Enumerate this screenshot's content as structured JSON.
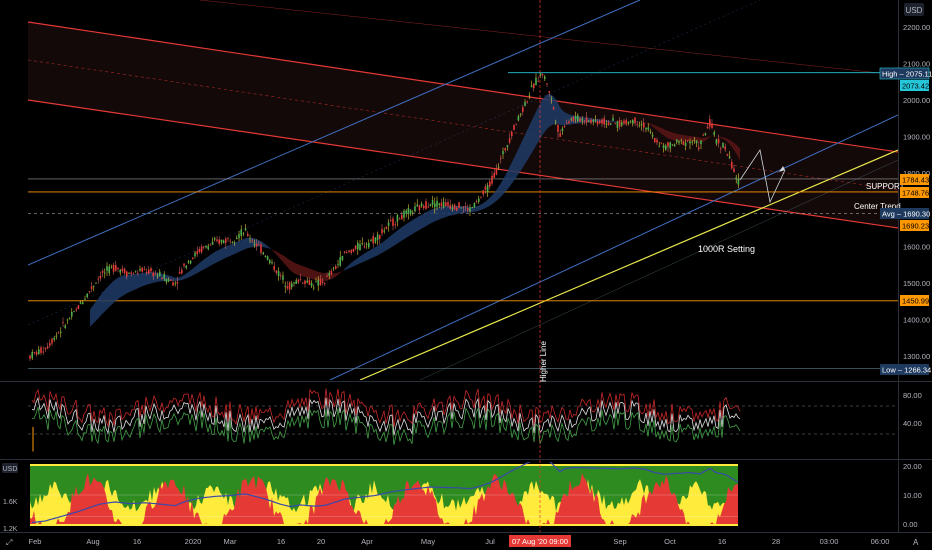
{
  "currency": "USD",
  "main_panel": {
    "price_ticks": [
      "2200.00",
      "2100.00",
      "2000.00",
      "1900.00",
      "1800.00",
      "1600.00",
      "1500.00",
      "1400.00",
      "1300.00"
    ],
    "price_tick_values": [
      2200,
      2100,
      2000,
      1900,
      1800,
      1600,
      1500,
      1400,
      1300
    ],
    "ylim": [
      1250,
      2290
    ],
    "badges": {
      "high": {
        "text": "High – 2075.11",
        "value": 2075.11
      },
      "last": {
        "text": "2073.42",
        "value": 2073.42
      },
      "r1784": {
        "text": "1784.43",
        "value": 1784.43
      },
      "r1748": {
        "text": "1748.76",
        "value": 1748.76
      },
      "avg": {
        "text": "Avg – 1690.30",
        "value": 1690.3
      },
      "r1690": {
        "text": "1690.23",
        "value": 1690.23
      },
      "r1450": {
        "text": "1450.99",
        "value": 1450.99
      },
      "low": {
        "text": "Low – 1266.34",
        "value": 1266.34
      }
    },
    "annotations": {
      "support": "SUPPORT",
      "center_trend": "Center Trend",
      "setting": "1000R Setting",
      "higher_line": "Higher Line"
    }
  },
  "rsi_panel": {
    "ticks": [
      "80.00",
      "40.00"
    ],
    "tick_values": [
      80,
      40
    ],
    "ylim": [
      0,
      100
    ]
  },
  "bottom_panel": {
    "currency": "USD",
    "left_ticks": [
      "1.6K",
      "1.2K"
    ],
    "right_ticks": [
      "20.00",
      "10.00",
      "0.00"
    ],
    "right_tick_values": [
      20,
      10,
      0
    ]
  },
  "time_axis": {
    "labels": [
      "Feb",
      "Aug",
      "16",
      "2020",
      "Mar",
      "16",
      "20",
      "Apr",
      "May",
      "Jul",
      "Sep",
      "Oct",
      "16",
      "28",
      "03:00",
      "06:00"
    ],
    "highlight": "07 Aug '20  09:00"
  },
  "chart_data": {
    "type": "line",
    "title": "",
    "series": [],
    "levels": {
      "high": 2075.11,
      "support": 1748.76,
      "avg": 1690.3,
      "lower": 1450.99,
      "low": 1266.34
    }
  },
  "colors": {
    "bg": "#000000",
    "candle_up": "#4caf50",
    "candle_down": "#e53935",
    "channel_red": "#e53935",
    "channel_blue": "#3f6fbf",
    "yellow_line": "#e8e84a",
    "orange_line": "#ff9800",
    "cyan_line": "#26c6da",
    "badge_orange": "#ff9800",
    "badge_navy": "#1e3a5f",
    "highlight_red": "#e53935"
  }
}
